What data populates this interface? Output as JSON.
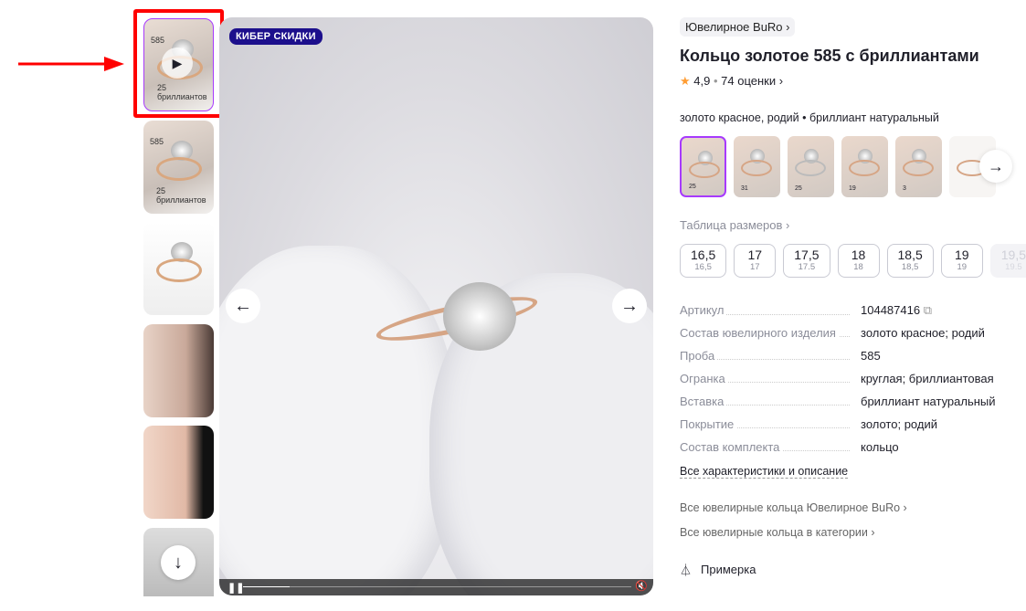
{
  "gallery": {
    "thumbnails": [
      {
        "type": "video",
        "label_585": "585",
        "caption": "25 бриллиантов"
      },
      {
        "type": "image",
        "label_585": "585",
        "caption": "25 бриллиантов"
      },
      {
        "type": "image",
        "label_585": "",
        "caption": ""
      },
      {
        "type": "image",
        "label_585": "",
        "caption": ""
      },
      {
        "type": "image",
        "label_585": "",
        "caption": ""
      },
      {
        "type": "image",
        "label_585": "",
        "caption": ""
      }
    ],
    "badge": "КИБЕР СКИДКИ",
    "video": {
      "progress_percent": 12
    }
  },
  "product": {
    "brand": "Ювелирное BuRo ›",
    "title": "Кольцо золотое 585 с бриллиантами",
    "rating": "4,9",
    "reviews": "74 оценки ›",
    "variant": "золото красное, родий • бриллиант натуральный",
    "colors": [
      "25",
      "31",
      "25",
      "19",
      "3",
      ""
    ],
    "size_table": "Таблица размеров ›",
    "sizes": [
      {
        "ru": "16,5",
        "alt": "16,5",
        "available": true
      },
      {
        "ru": "17",
        "alt": "17",
        "available": true
      },
      {
        "ru": "17,5",
        "alt": "17.5",
        "available": true
      },
      {
        "ru": "18",
        "alt": "18",
        "available": true
      },
      {
        "ru": "18,5",
        "alt": "18,5",
        "available": true
      },
      {
        "ru": "19",
        "alt": "19",
        "available": true
      },
      {
        "ru": "19,5",
        "alt": "19.5",
        "available": false
      }
    ],
    "specs": [
      {
        "label": "Артикул",
        "value": "104487416"
      },
      {
        "label": "Состав ювелирного изделия",
        "value": "золото красное; родий"
      },
      {
        "label": "Проба",
        "value": "585"
      },
      {
        "label": "Огранка",
        "value": "круглая; бриллиантовая"
      },
      {
        "label": "Вставка",
        "value": "бриллиант натуральный"
      },
      {
        "label": "Покрытие",
        "value": "золото; родий"
      },
      {
        "label": "Состав комплекта",
        "value": "кольцо"
      }
    ],
    "all_specs": "Все характеристики и описание",
    "link_brand": "Все ювелирные кольца Ювелирное BuRo ›",
    "link_category": "Все ювелирные кольца в категории ›",
    "fitting": "Примерка"
  },
  "colors": {
    "accent": "#a73afd",
    "badge": "#1c0f8c",
    "star": "#ff9d33",
    "annotation": "#ff0000"
  }
}
